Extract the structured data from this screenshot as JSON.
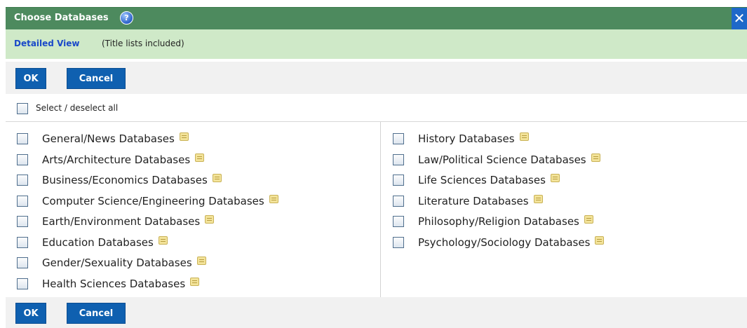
{
  "dialog": {
    "title": "Choose Databases",
    "help_icon": "?",
    "close_icon": "✕"
  },
  "view": {
    "link": "Detailed View",
    "note": "(Title lists included)"
  },
  "buttons": {
    "ok": "OK",
    "cancel": "Cancel"
  },
  "select_all": {
    "label": "Select / deselect all",
    "checked": false
  },
  "databases": {
    "left": [
      {
        "label": "General/News Databases",
        "checked": false
      },
      {
        "label": "Arts/Architecture Databases",
        "checked": false
      },
      {
        "label": "Business/Economics Databases",
        "checked": false
      },
      {
        "label": "Computer Science/Engineering Databases",
        "checked": false
      },
      {
        "label": "Earth/Environment Databases",
        "checked": false
      },
      {
        "label": "Education Databases",
        "checked": false
      },
      {
        "label": "Gender/Sexuality Databases",
        "checked": false
      },
      {
        "label": "Health Sciences Databases",
        "checked": false
      }
    ],
    "right": [
      {
        "label": "History Databases",
        "checked": false
      },
      {
        "label": "Law/Political Science Databases",
        "checked": false
      },
      {
        "label": "Life Sciences Databases",
        "checked": false
      },
      {
        "label": "Literature Databases",
        "checked": false
      },
      {
        "label": "Philosophy/Religion Databases",
        "checked": false
      },
      {
        "label": "Psychology/Sociology Databases",
        "checked": false
      }
    ]
  },
  "icons": {
    "info": "note-icon",
    "help": "help-icon",
    "close": "close-icon"
  }
}
